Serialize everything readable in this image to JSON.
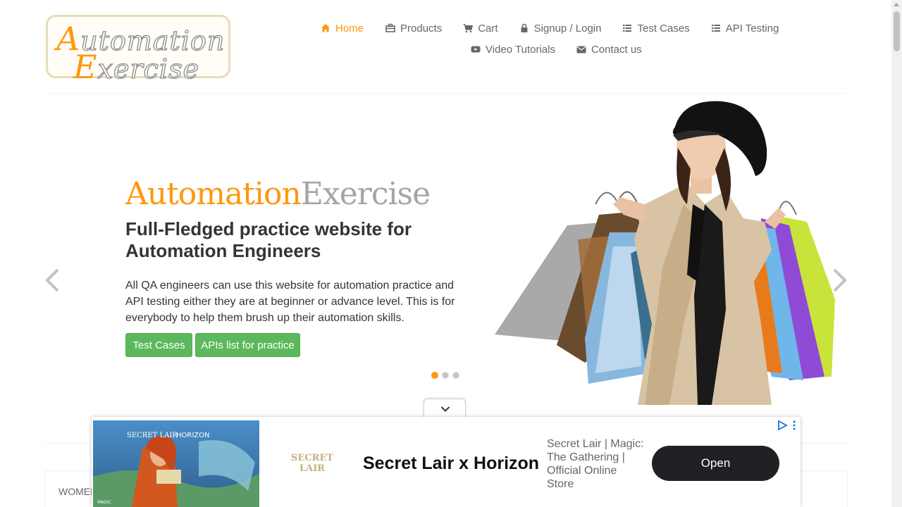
{
  "logo": {
    "line1_cap": "A",
    "line1_rest": "utomation",
    "line2_cap": "E",
    "line2_rest": "xercise"
  },
  "nav": [
    {
      "label": "Home",
      "icon": "home-icon",
      "active": true
    },
    {
      "label": "Products",
      "icon": "products-icon"
    },
    {
      "label": "Cart",
      "icon": "cart-icon"
    },
    {
      "label": "Signup / Login",
      "icon": "lock-icon"
    },
    {
      "label": "Test Cases",
      "icon": "list-icon"
    },
    {
      "label": "API Testing",
      "icon": "list-icon"
    },
    {
      "label": "Video Tutorials",
      "icon": "youtube-icon"
    },
    {
      "label": "Contact us",
      "icon": "envelope-icon"
    }
  ],
  "slider": {
    "brand_part1": "Automation",
    "brand_part2": "Exercise",
    "headline": "Full-Fledged practice website for Automation Engineers",
    "description": "All QA engineers can use this website for automation practice and API testing either they are at beginner or advance level. This is for everybody to help them brush up their automation skills.",
    "btn_test_cases": "Test Cases",
    "btn_apis": "APIs list for practice",
    "active_slide": 1,
    "slide_count": 3
  },
  "category": {
    "label": "WOMEN"
  },
  "ad": {
    "title": "Secret Lair x Horizon",
    "subtitle": "Secret Lair | Magic: The Gathering | Official Online Store",
    "open_label": "Open",
    "logo_text_1": "SECRET",
    "logo_text_2": "LAIR",
    "image_text_1": "SECRET LAIR",
    "image_text_2": "HORIZON",
    "image_text_3": "MAGIC"
  },
  "colors": {
    "accent": "#fe980f",
    "green": "#5cb85c",
    "text": "#696763",
    "dark": "#363432"
  }
}
